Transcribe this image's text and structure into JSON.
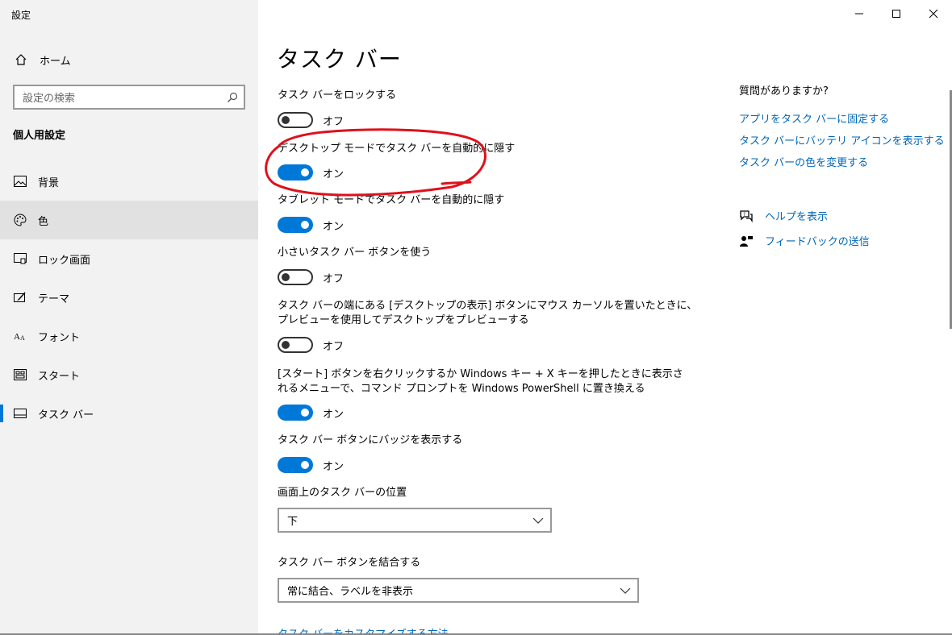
{
  "window": {
    "title": "設定"
  },
  "sidebar": {
    "home_label": "ホーム",
    "search_placeholder": "設定の検索",
    "section_title": "個人用設定",
    "items": [
      {
        "label": "背景",
        "icon": "picture-icon"
      },
      {
        "label": "色",
        "icon": "palette-icon",
        "selected": true
      },
      {
        "label": "ロック画面",
        "icon": "lock-screen-icon"
      },
      {
        "label": "テーマ",
        "icon": "theme-icon"
      },
      {
        "label": "フォント",
        "icon": "font-icon"
      },
      {
        "label": "スタート",
        "icon": "start-icon"
      },
      {
        "label": "タスク バー",
        "icon": "taskbar-icon",
        "active": true
      }
    ]
  },
  "main": {
    "title": "タスク バー",
    "settings": [
      {
        "label": "タスク バーをロックする",
        "state": "オフ",
        "on": false
      },
      {
        "label": "デスクトップ モードでタスク バーを自動的に隠す",
        "state": "オン",
        "on": true
      },
      {
        "label": "タブレット モードでタスク バーを自動的に隠す",
        "state": "オン",
        "on": true
      },
      {
        "label": "小さいタスク バー ボタンを使う",
        "state": "オフ",
        "on": false
      },
      {
        "label_line1": "タスク バーの端にある [デスクトップの表示] ボタンにマウス カーソルを置いたときに、",
        "label_line2": "プレビューを使用してデスクトップをプレビューする",
        "state": "オフ",
        "on": false
      },
      {
        "label_line1": "[スタート] ボタンを右クリックするか Windows キー + X キーを押したときに表示さ",
        "label_line2": "れるメニューで、コマンド プロンプトを Windows PowerShell に置き換える",
        "state": "オン",
        "on": true
      },
      {
        "label": "タスク バー ボタンにバッジを表示する",
        "state": "オン",
        "on": true
      }
    ],
    "position": {
      "label": "画面上のタスク バーの位置",
      "value": "下"
    },
    "combine": {
      "label": "タスク バー ボタンを結合する",
      "value": "常に結合、ラベルを非表示"
    },
    "footer_link": "タスク バーをカスタマイズする方法"
  },
  "help": {
    "title": "質問がありますか?",
    "links": [
      "アプリをタスク バーに固定する",
      "タスク バーにバッテリ アイコンを表示する",
      "タスク バーの色を変更する"
    ],
    "get_help": "ヘルプを表示",
    "feedback": "フィードバックの送信"
  },
  "colors": {
    "accent": "#0078d7",
    "link": "#0067b8",
    "annotation": "#e0101a"
  }
}
